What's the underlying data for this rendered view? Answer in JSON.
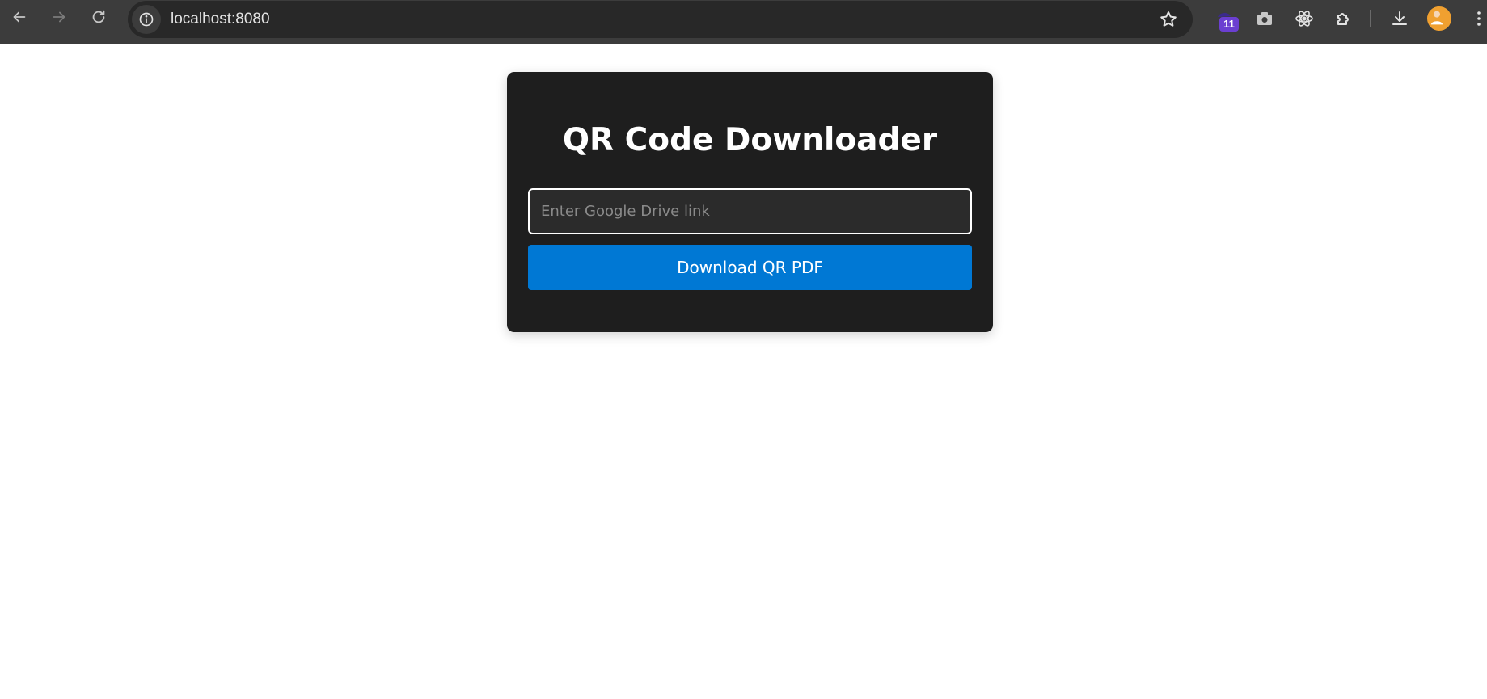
{
  "browser": {
    "url": "localhost:8080",
    "extension_badge": "11",
    "accent_colors": {
      "chrome_bg": "#3c3c3c",
      "omnibox_bg": "#282828",
      "badge": "#6b3fd1"
    }
  },
  "page": {
    "title": "QR Code Downloader",
    "input": {
      "placeholder": "Enter Google Drive link",
      "value": ""
    },
    "download_button_label": "Download QR PDF",
    "colors": {
      "card_bg": "#1e1e1e",
      "button_bg": "#0078d4"
    }
  },
  "icons": [
    "back-arrow-icon",
    "forward-arrow-icon",
    "reload-icon",
    "site-info-icon",
    "bookmark-star-icon",
    "extension-badge-icon",
    "camera-icon",
    "react-icon",
    "puzzle-extensions-icon",
    "download-icon",
    "profile-avatar",
    "kebab-menu-icon"
  ]
}
